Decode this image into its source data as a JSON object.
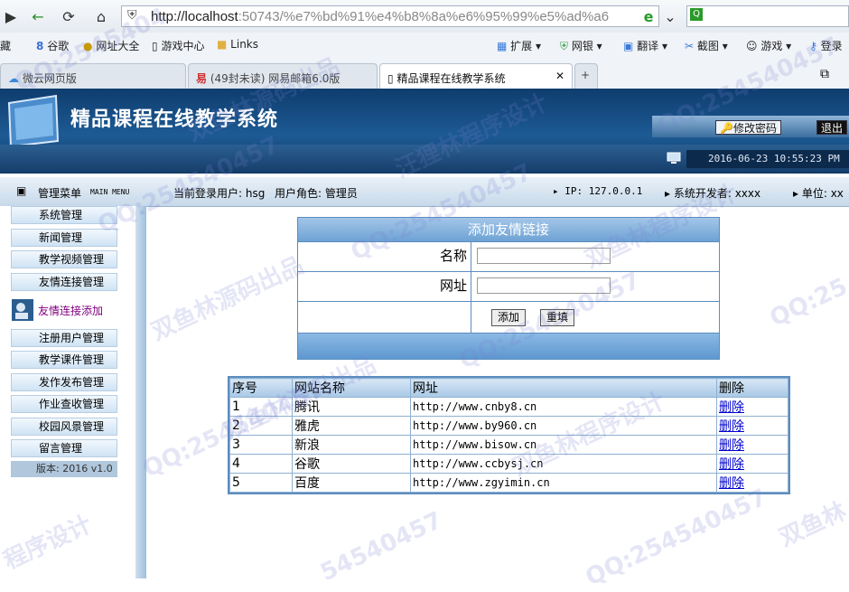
{
  "browser": {
    "address_host": "http://localhost",
    "address_rest": ":50743/%e7%bd%91%e4%b8%8a%e6%95%99%e5%ad%a6",
    "search_placeholder": "",
    "bookmarks": [
      "藏",
      "谷歌",
      "网址大全",
      "游戏中心",
      "Links",
      "扩展",
      "网银",
      "翻译",
      "截图",
      "游戏",
      "登录"
    ],
    "tabs": [
      {
        "label": "微云网页版",
        "active": false
      },
      {
        "label": "(49封未读) 网易邮箱6.0版",
        "active": false
      },
      {
        "label": "精品课程在线教学系统",
        "active": true
      }
    ]
  },
  "header": {
    "title": "精品课程在线教学系统",
    "change_password": "修改密码",
    "logout": "退出",
    "datetime": "2016-06-23 10:55:23 PM"
  },
  "infobar": {
    "menu_title": "管理菜单",
    "menu_sub": "MAIN MENU",
    "current_user": "当前登录用户: hsg",
    "user_role": "用户角色: 管理员",
    "ip": "IP: 127.0.0.1",
    "developer": "系统开发者: xxxx",
    "unit": "单位: xx"
  },
  "sidebar": {
    "items_top": [
      "系统管理",
      "新闻管理",
      "教学视频管理",
      "友情连接管理"
    ],
    "active_item": "友情连接添加",
    "items_bottom": [
      "注册用户管理",
      "教学课件管理",
      "发作发布管理",
      "作业查收管理",
      "校园风景管理",
      "留言管理"
    ],
    "version": "版本: 2016 v1.0"
  },
  "form": {
    "title": "添加友情链接",
    "name_label": "名称",
    "name_value": "",
    "url_label": "网址",
    "url_value": "",
    "add_button": "添加",
    "reset_button": "重填"
  },
  "links_table": {
    "headers": [
      "序号",
      "网站名称",
      "网址",
      "删除"
    ],
    "rows": [
      {
        "no": "1",
        "name": "腾讯",
        "url": "http://www.cnby8.cn",
        "del": "删除"
      },
      {
        "no": "2",
        "name": "雅虎",
        "url": "http://www.by960.cn",
        "del": "删除"
      },
      {
        "no": "3",
        "name": "新浪",
        "url": "http://www.bisow.cn",
        "del": "删除"
      },
      {
        "no": "4",
        "name": "谷歌",
        "url": "http://www.ccbysj.cn",
        "del": "删除"
      },
      {
        "no": "5",
        "name": "百度",
        "url": "http://www.zgyimin.cn",
        "del": "删除"
      }
    ]
  },
  "watermarks": [
    "QQ:2545404",
    "双鱼林源码出品",
    "汪狸林程序设计",
    "QQ:254540457",
    "QQ:254540457",
    "双鱼林源码出品",
    "QQ:254540457",
    "双鱼林程序设计",
    "QQ:254540457",
    "双鱼林源码出品",
    "QQ:254540457",
    "双鱼林程序设计",
    "QQ:25",
    "程序设计",
    "54540457",
    "QQ:254540457",
    "双鱼林"
  ],
  "colors": {
    "header_bg": "#1d5a94",
    "table_border": "#5b8dbf",
    "active_link": "#800080"
  }
}
